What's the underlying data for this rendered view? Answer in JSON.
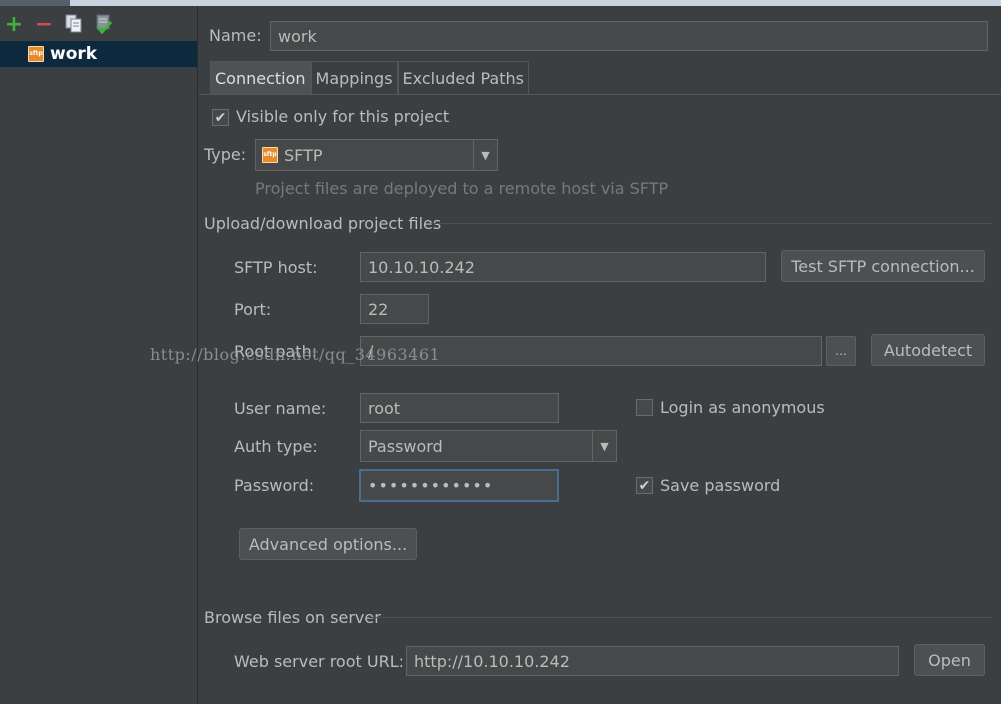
{
  "sidebar": {
    "toolbar": {
      "add": "+",
      "remove": "−"
    },
    "items": [
      {
        "label": "work",
        "badge": "sftp"
      }
    ]
  },
  "form": {
    "name_label": "Name:",
    "name_value": "work",
    "tabs": [
      {
        "label": "Connection"
      },
      {
        "label": "Mappings"
      },
      {
        "label": "Excluded Paths"
      }
    ],
    "visible_only_label": "Visible only for this project",
    "visible_only_checked": true,
    "type_label": "Type:",
    "type_value": "SFTP",
    "type_badge": "sftp",
    "type_hint": "Project files are deployed to a remote host via SFTP",
    "upload_section": "Upload/download project files",
    "host_label": "SFTP host:",
    "host_value": "10.10.10.242",
    "test_button": "Test SFTP connection...",
    "port_label": "Port:",
    "port_value": "22",
    "root_label": "Root path:",
    "root_value": "/",
    "browse_button": "...",
    "autodetect_button": "Autodetect",
    "user_label": "User name:",
    "user_value": "root",
    "anon_label": "Login as anonymous",
    "anon_checked": false,
    "auth_label": "Auth type:",
    "auth_value": "Password",
    "password_label": "Password:",
    "password_value": "••••••••••••",
    "save_password_label": "Save password",
    "save_password_checked": true,
    "advanced_button": "Advanced options...",
    "browse_section": "Browse files on server",
    "web_url_label": "Web server root URL:",
    "web_url_value": "http://10.10.10.242",
    "open_button": "Open"
  },
  "watermark": "http://blog.csdn.net/qq_34963461"
}
